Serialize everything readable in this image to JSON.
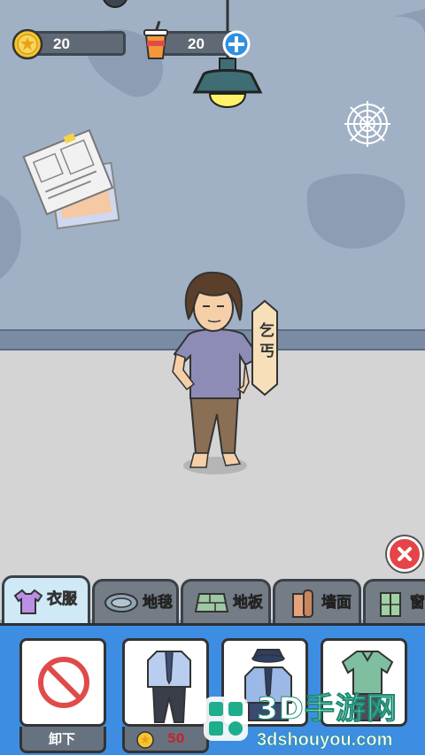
{
  "hud": {
    "coins": "20",
    "drinks": "20",
    "coin_icon": "coin-icon",
    "drink_icon": "drink-cup-icon",
    "add_icon": "plus-icon"
  },
  "character": {
    "name_tag": "乞丐"
  },
  "tabs": [
    {
      "label": "衣服",
      "icon": "shirt-icon",
      "active": true
    },
    {
      "label": "地毯",
      "icon": "rug-icon",
      "active": false
    },
    {
      "label": "地板",
      "icon": "floor-icon",
      "active": false
    },
    {
      "label": "墙面",
      "icon": "wallpaper-icon",
      "active": false
    },
    {
      "label": "窗",
      "icon": "window-icon",
      "active": false
    }
  ],
  "items": [
    {
      "footer": "卸下",
      "icon": "no-sign-icon"
    },
    {
      "price": "50",
      "icon": "business-suit-icon"
    },
    {
      "icon": "police-uniform-icon"
    },
    {
      "icon": "polo-outfit-icon"
    }
  ],
  "watermark": {
    "brand": "3D手游网",
    "url": "3dshouyou.com"
  },
  "colors": {
    "wall": "#a1b1c5",
    "floor": "#d4d4d4",
    "panel": "#3d8ee2",
    "active_tab": "#cfe9f6",
    "tab": "#747c86",
    "close": "#e54548"
  }
}
